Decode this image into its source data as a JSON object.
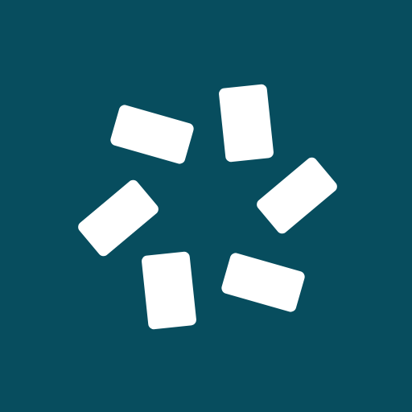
{
  "app_icon": {
    "icon": "six-cards-pinwheel-icon",
    "background_color": "#074D5E",
    "card_color": "#FFFFFF",
    "card_count": 6
  }
}
